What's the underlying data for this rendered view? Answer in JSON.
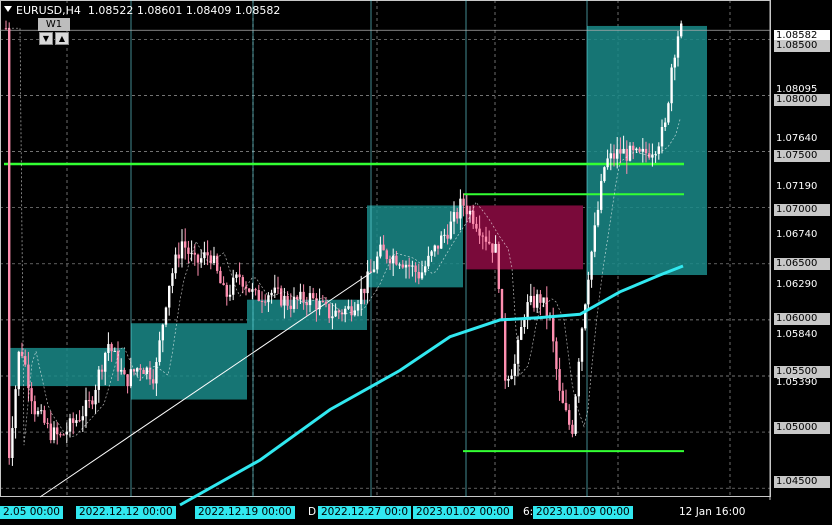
{
  "header": {
    "symbol": "EURUSD,H4",
    "open": "1.08522",
    "high": "1.08601",
    "low": "1.08409",
    "close": "1.08582"
  },
  "period_button": {
    "label": "W1",
    "down": "▼",
    "up": "▲"
  },
  "y_axis": {
    "labels": [
      {
        "text": "1.08582",
        "style": "price"
      },
      {
        "text": "1.08500",
        "style": "box"
      },
      {
        "text": "1.08095",
        "style": "plain"
      },
      {
        "text": "1.08000",
        "style": "box"
      },
      {
        "text": "1.07640",
        "style": "plain"
      },
      {
        "text": "1.07500",
        "style": "box"
      },
      {
        "text": "1.07190",
        "style": "plain"
      },
      {
        "text": "1.07000",
        "style": "box"
      },
      {
        "text": "1.06740",
        "style": "plain"
      },
      {
        "text": "1.06500",
        "style": "box"
      },
      {
        "text": "1.06290",
        "style": "plain"
      },
      {
        "text": "1.06000",
        "style": "box"
      },
      {
        "text": "1.05840",
        "style": "plain"
      },
      {
        "text": "1.05500",
        "style": "box"
      },
      {
        "text": "1.05390",
        "style": "plain"
      },
      {
        "text": "1.05000",
        "style": "box"
      },
      {
        "text": "1.04500",
        "style": "box"
      }
    ]
  },
  "x_axis": {
    "labels": [
      {
        "text": "2.05 00:00",
        "style": "hl"
      },
      {
        "text": "2022.12.12 00:00",
        "style": "hl"
      },
      {
        "text": "2022.12.19 00:00",
        "style": "hl"
      },
      {
        "text": "D",
        "style": "plain"
      },
      {
        "text": "2022.12.27 00:0",
        "style": "hl"
      },
      {
        "text": "2023.01.02 00:00",
        "style": "hl"
      },
      {
        "text": "6:",
        "style": "plain"
      },
      {
        "text": "2023.01.09 00:00",
        "style": "hl"
      },
      {
        "text": "12 Jan 16:00",
        "style": "plain"
      }
    ]
  },
  "colors": {
    "background": "#000000",
    "bull": "#ffffff",
    "bear": "#ff8fb0",
    "moving_average": "#31e8f0",
    "zone_fill": "#1a8a88",
    "zone_bear": "#7a0a3a",
    "level_lines": "#33ff33",
    "separator_lines": "#6ee7ee",
    "grid": "#c0c0c0"
  },
  "chart_data": {
    "type": "candlestick",
    "symbol": "EURUSD",
    "timeframe": "H4",
    "ylim": [
      1.0435,
      1.0878
    ],
    "horizontal_levels": [
      1.0739,
      1.0712,
      1.0483
    ],
    "last_price": 1.08582
  }
}
